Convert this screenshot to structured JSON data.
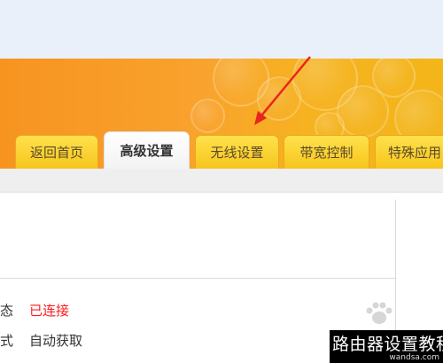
{
  "tabs": [
    {
      "label": "返回首页",
      "active": false
    },
    {
      "label": "高级设置",
      "active": true
    },
    {
      "label": "无线设置",
      "active": false
    },
    {
      "label": "带宽控制",
      "active": false
    },
    {
      "label": "特殊应用",
      "active": false
    }
  ],
  "status_rows": [
    {
      "label": "态",
      "value": "已连接",
      "value_color": "#ff1a1a"
    },
    {
      "label": "式",
      "value": "自动获取"
    }
  ],
  "annotation": {
    "arrow_color": "#e8261c",
    "points_to": "无线设置"
  },
  "watermark": {
    "title": "路由器设置教程",
    "site": "wandsa.com"
  },
  "colors": {
    "header_orange": "#f79420",
    "tab_yellow": "#f7c51b",
    "active_tab": "#ffffff"
  }
}
